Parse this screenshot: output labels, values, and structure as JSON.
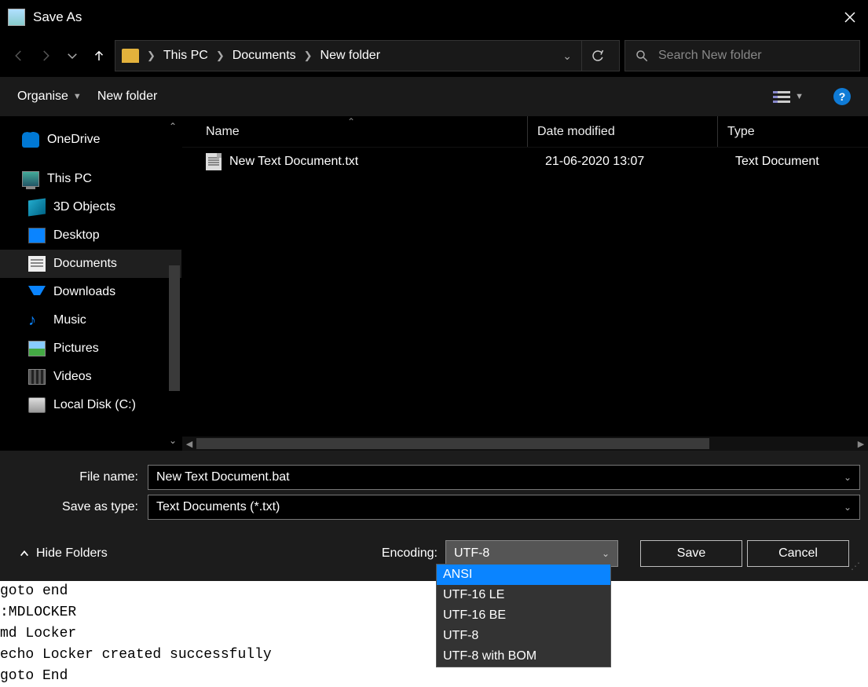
{
  "titlebar": {
    "title": "Save As"
  },
  "nav": {
    "breadcrumbs": [
      "This PC",
      "Documents",
      "New folder"
    ],
    "search_placeholder": "Search New folder"
  },
  "toolbar": {
    "organise": "Organise",
    "new_folder": "New folder"
  },
  "tree": {
    "items": [
      {
        "label": "OneDrive",
        "icon": "onedrive",
        "root": true
      },
      {
        "gap": true
      },
      {
        "label": "This PC",
        "icon": "pc",
        "root": true
      },
      {
        "label": "3D Objects",
        "icon": "3d"
      },
      {
        "label": "Desktop",
        "icon": "desktop"
      },
      {
        "label": "Documents",
        "icon": "doc",
        "selected": true
      },
      {
        "label": "Downloads",
        "icon": "down"
      },
      {
        "label": "Music",
        "icon": "music"
      },
      {
        "label": "Pictures",
        "icon": "pic"
      },
      {
        "label": "Videos",
        "icon": "vid"
      },
      {
        "label": "Local Disk (C:)",
        "icon": "disk"
      }
    ]
  },
  "files": {
    "columns": {
      "name": "Name",
      "date": "Date modified",
      "type": "Type"
    },
    "rows": [
      {
        "name": "New Text Document.txt",
        "date": "21-06-2020 13:07",
        "type": "Text Document"
      }
    ]
  },
  "form": {
    "filename_label": "File name:",
    "filename_value": "New Text Document.bat",
    "type_label": "Save as type:",
    "type_value": "Text Documents (*.txt)"
  },
  "actions": {
    "hide_folders": "Hide Folders",
    "encoding_label": "Encoding:",
    "encoding_value": "UTF-8",
    "encoding_options": [
      "ANSI",
      "UTF-16 LE",
      "UTF-16 BE",
      "UTF-8",
      "UTF-8 with BOM"
    ],
    "save": "Save",
    "cancel": "Cancel"
  },
  "behind_text": "goto end\n:MDLOCKER\nmd Locker\necho Locker created successfully\ngoto End"
}
